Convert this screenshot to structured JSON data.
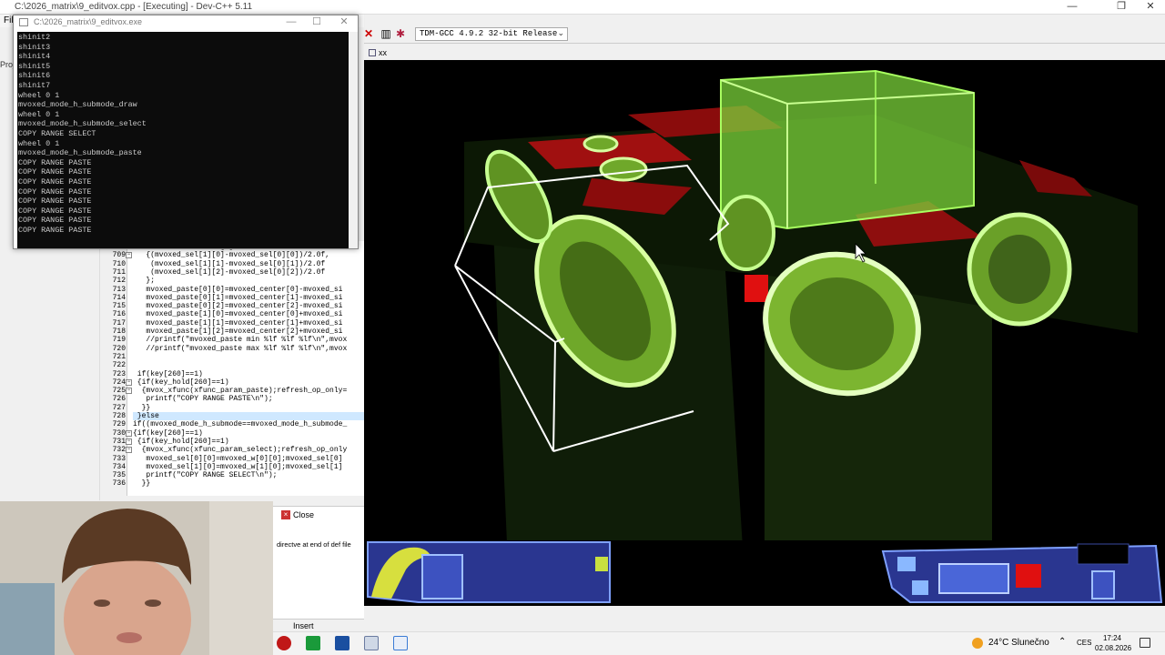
{
  "ide": {
    "title": "C:\\2026_matrix\\9_editvox.cpp - [Executing] - Dev-C++ 5.11",
    "menu_file": "File",
    "project_tab": "Proj",
    "compiler": "TDM-GCC 4.9.2 32-bit Release"
  },
  "console": {
    "title": "C:\\2026_matrix\\9_editvox.exe",
    "lines": [
      "shinit2",
      "shinit3",
      "shinit4",
      "shinit5",
      "shinit6",
      "shinit7",
      "wheel 0 1",
      "mvoxed_mode_h_submode_draw",
      "wheel 0 1",
      "mvoxed_mode_h_submode_select",
      "COPY RANGE SELECT",
      "wheel 0 1",
      "mvoxed_mode_h_submode_paste",
      "COPY RANGE PASTE",
      "COPY RANGE PASTE",
      "COPY RANGE PASTE",
      "COPY RANGE PASTE",
      "COPY RANGE PASTE",
      "COPY RANGE PASTE",
      "COPY RANGE PASTE",
      "COPY RANGE PASTE"
    ]
  },
  "editor": {
    "lines": [
      {
        "n": "",
        "code": "   float mvoxed_size[3]="
      },
      {
        "n": "709",
        "code": "   {(mvoxed_sel[1][0]-mvoxed_sel[0][0])/2.0f,"
      },
      {
        "n": "710",
        "code": "    (mvoxed_sel[1][1]-mvoxed_sel[0][1])/2.0f"
      },
      {
        "n": "711",
        "code": "    (mvoxed_sel[1][2]-mvoxed_sel[0][2])/2.0f"
      },
      {
        "n": "712",
        "code": "   };"
      },
      {
        "n": "713",
        "code": "   mvoxed_paste[0][0]=mvoxed_center[0]-mvoxed_si"
      },
      {
        "n": "714",
        "code": "   mvoxed_paste[0][1]=mvoxed_center[1]-mvoxed_si"
      },
      {
        "n": "715",
        "code": "   mvoxed_paste[0][2]=mvoxed_center[2]-mvoxed_si"
      },
      {
        "n": "716",
        "code": "   mvoxed_paste[1][0]=mvoxed_center[0]+mvoxed_si"
      },
      {
        "n": "717",
        "code": "   mvoxed_paste[1][1]=mvoxed_center[1]+mvoxed_si"
      },
      {
        "n": "718",
        "code": "   mvoxed_paste[1][2]=mvoxed_center[2]+mvoxed_si"
      },
      {
        "n": "719",
        "code": "   //printf(\"mvoxed_paste min %lf %lf %lf\\n\",mvox"
      },
      {
        "n": "720",
        "code": "   //printf(\"mvoxed_paste max %lf %lf %lf\\n\",mvox"
      },
      {
        "n": "721",
        "code": ""
      },
      {
        "n": "722",
        "code": ""
      },
      {
        "n": "723",
        "code": " if(key[260]==1)"
      },
      {
        "n": "724",
        "code": " {if(key_hold[260]==1)"
      },
      {
        "n": "725",
        "code": "  {mvox_xfunc(xfunc_param_paste);refresh_op_only="
      },
      {
        "n": "726",
        "code": "   printf(\"COPY RANGE PASTE\\n\");"
      },
      {
        "n": "727",
        "code": "  }}"
      },
      {
        "n": "728",
        "code": " }else"
      },
      {
        "n": "729",
        "code": "if((mvoxed_mode_h_submode==mvoxed_mode_h_submode_"
      },
      {
        "n": "730",
        "code": "{if(key[260]==1)"
      },
      {
        "n": "731",
        "code": " {if(key_hold[260]==1)"
      },
      {
        "n": "732",
        "code": "  {mvox_xfunc(xfunc_param_select);refresh_op_only"
      },
      {
        "n": "733",
        "code": "   mvoxed_sel[0][0]=mvoxed_w[0][0];mvoxed_sel[0]"
      },
      {
        "n": "734",
        "code": "   mvoxed_sel[1][0]=mvoxed_w[1][0];mvoxed_sel[1]"
      },
      {
        "n": "735",
        "code": "   printf(\"COPY RANGE SELECT\\n\");"
      },
      {
        "n": "736",
        "code": "  }}"
      }
    ]
  },
  "messages": {
    "close_label": "Close",
    "text": "directve at end of def file",
    "status_insert": "Insert"
  },
  "game": {
    "tab_label": "xx"
  },
  "taskbar": {
    "weather": "24°C  Slunečno",
    "lang": "CES",
    "time": "17:24",
    "date": "02.08.2026"
  },
  "colors": {
    "green_box": "#7ad23a",
    "red_tile": "#c01010",
    "hud_blue": "#2c3fa0",
    "console_bg": "#0c0c0c"
  }
}
